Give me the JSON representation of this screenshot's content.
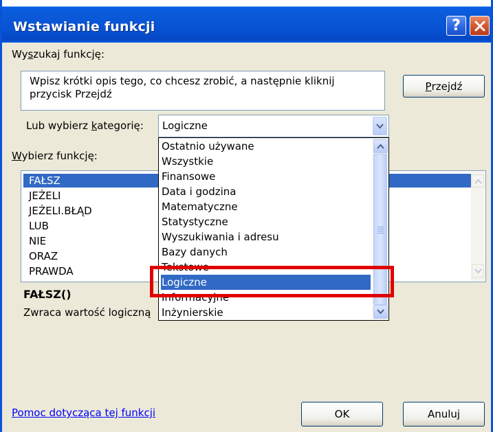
{
  "dialog": {
    "title": "Wstawianie funkcji",
    "help_button": "?",
    "search_label_prefix": "Wy",
    "search_label_hotkey": "s",
    "search_label_suffix": "zukaj funkcję:",
    "search_text_line1": "Wpisz krótki opis tego, co chcesz zrobić, a następnie kliknij",
    "search_text_line2": "przycisk Przejdź",
    "go_button_prefix": "",
    "go_button_hotkey": "P",
    "go_button_suffix": "rzejdź",
    "category_label_prefix": "Lub wybierz ",
    "category_label_hotkey": "k",
    "category_label_suffix": "ategorię:",
    "category_value": "Logiczne",
    "function_label_prefix": "",
    "function_label_hotkey": "W",
    "function_label_suffix": "ybierz funkcję:",
    "functions": [
      "FAŁSZ",
      "JEŻELI",
      "JEŻELI.BŁĄD",
      "LUB",
      "NIE",
      "ORAZ",
      "PRAWDA"
    ],
    "selected_function": "FAŁSZ",
    "syntax": "FAŁSZ()",
    "description": "Zwraca wartość logiczną",
    "help_link": "Pomoc dotycząca tej funkcji",
    "ok_button": "OK",
    "cancel_button": "Anuluj"
  },
  "category_dropdown": {
    "items": [
      "Ostatnio używane",
      "Wszystkie",
      "Finansowe",
      "Data i godzina",
      "Matematyczne",
      "Statystyczne",
      "Wyszukiwania i adresu",
      "Bazy danych",
      "Tekstowe",
      "Logiczne",
      "Informacyjne",
      "Inżynierskie"
    ],
    "selected": "Logiczne"
  },
  "colors": {
    "highlight": "#316ac5",
    "annotation_box": "#e00000",
    "window_bg": "#ece9d8",
    "titlebar": "#0a5ad8"
  }
}
